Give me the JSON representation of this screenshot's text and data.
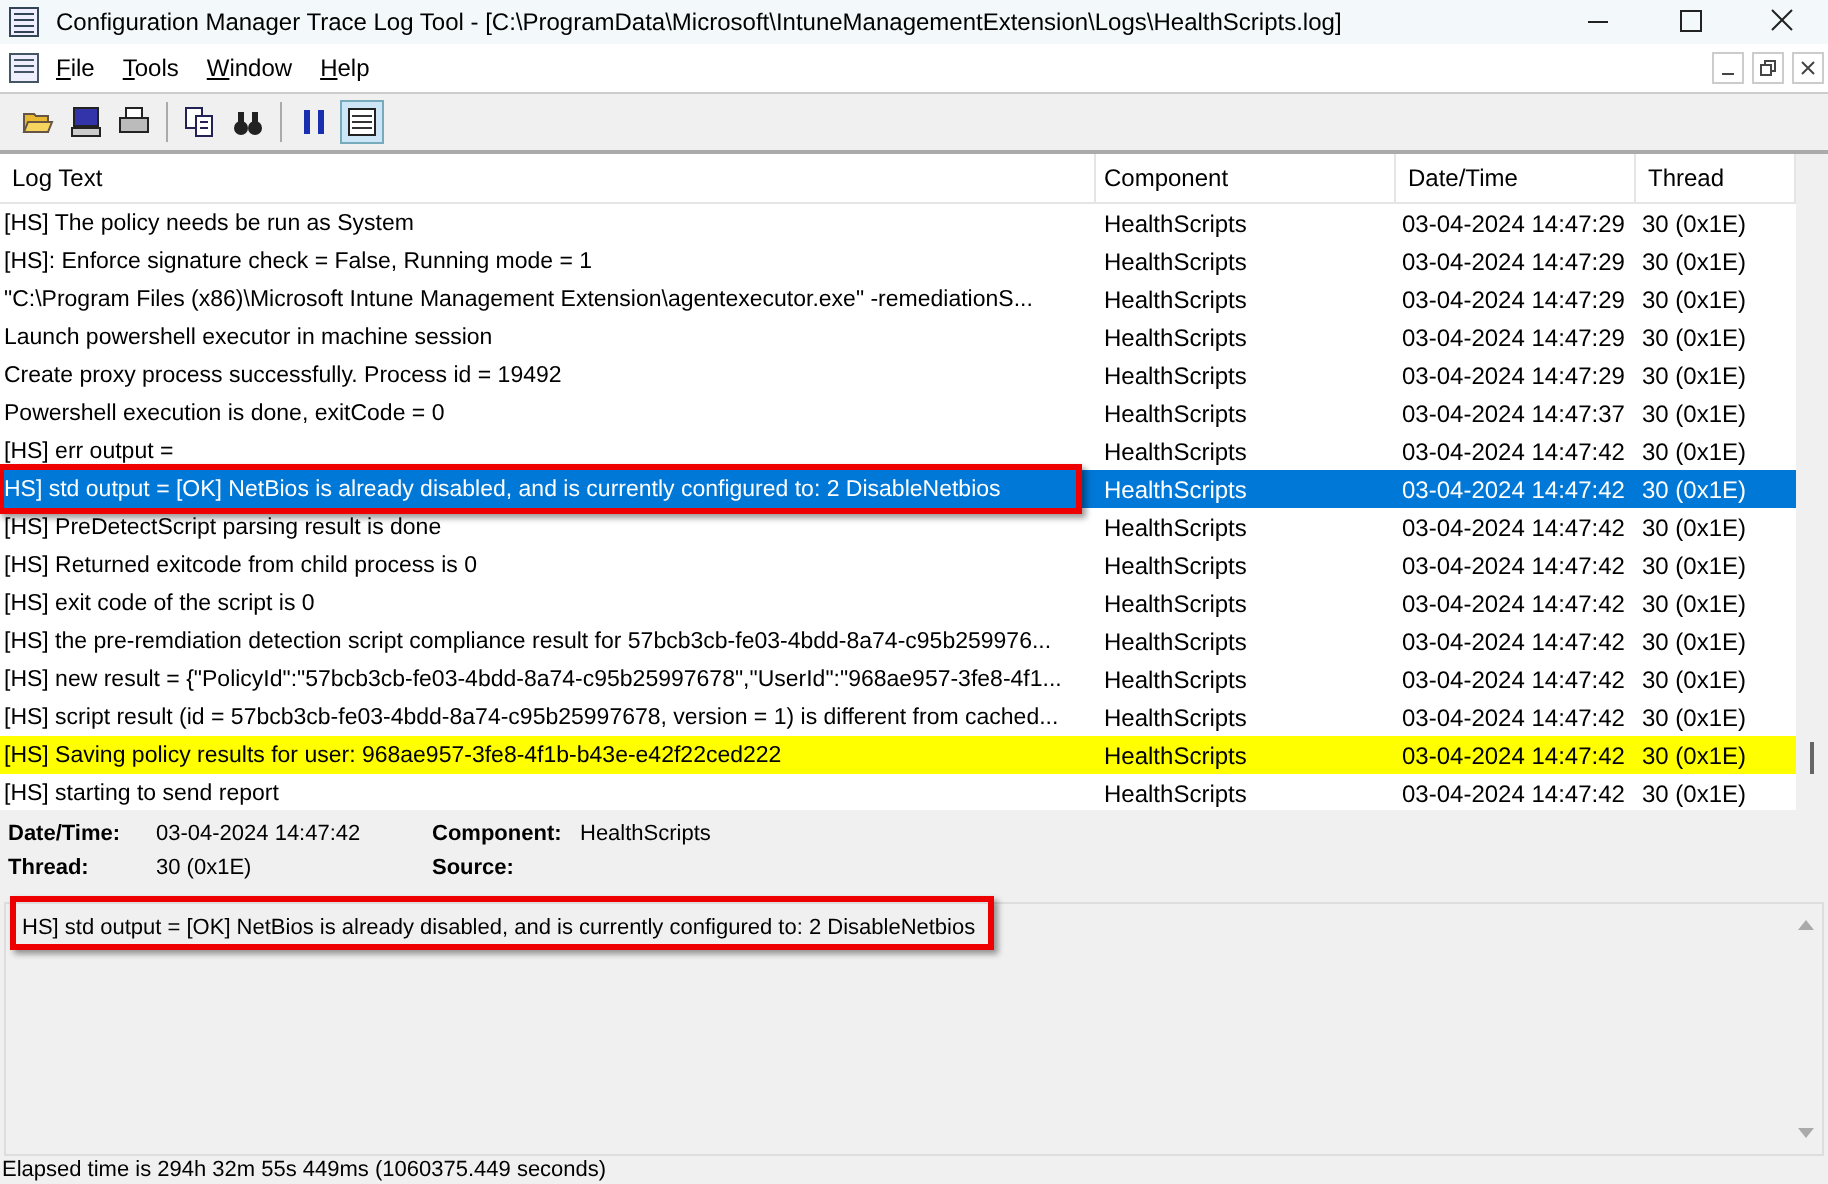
{
  "window": {
    "title": "Configuration Manager Trace Log Tool - [C:\\ProgramData\\Microsoft\\IntuneManagementExtension\\Logs\\HealthScripts.log]"
  },
  "menu": [
    {
      "label": "File"
    },
    {
      "label": "Tools"
    },
    {
      "label": "Window"
    },
    {
      "label": "Help"
    }
  ],
  "toolbar": [
    {
      "kind": "open",
      "pressed": false
    },
    {
      "kind": "computer",
      "pressed": false
    },
    {
      "kind": "print",
      "pressed": false
    },
    {
      "kind": "copy",
      "pressed": false
    },
    {
      "kind": "find",
      "pressed": false
    },
    {
      "kind": "pause",
      "pressed": false
    },
    {
      "kind": "view",
      "pressed": true
    }
  ],
  "table": {
    "columns": [
      "Log Text",
      "Component",
      "Date/Time",
      "Thread"
    ],
    "rows": [
      {
        "text": "[HS] The policy needs be run as System",
        "component": "HealthScripts",
        "datetime": "03-04-2024 14:47:29",
        "thread": "30 (0x1E)",
        "selected": false,
        "highlighted": false,
        "callout": false
      },
      {
        "text": "[HS]: Enforce signature check = False, Running mode = 1",
        "component": "HealthScripts",
        "datetime": "03-04-2024 14:47:29",
        "thread": "30 (0x1E)",
        "selected": false,
        "highlighted": false,
        "callout": false
      },
      {
        "text": "\"C:\\Program Files (x86)\\Microsoft Intune Management Extension\\agentexecutor.exe\"  -remediationS...",
        "component": "HealthScripts",
        "datetime": "03-04-2024 14:47:29",
        "thread": "30 (0x1E)",
        "selected": false,
        "highlighted": false,
        "callout": false
      },
      {
        "text": "Launch powershell executor in machine session",
        "component": "HealthScripts",
        "datetime": "03-04-2024 14:47:29",
        "thread": "30 (0x1E)",
        "selected": false,
        "highlighted": false,
        "callout": false
      },
      {
        "text": "Create proxy process successfully. Process id = 19492",
        "component": "HealthScripts",
        "datetime": "03-04-2024 14:47:29",
        "thread": "30 (0x1E)",
        "selected": false,
        "highlighted": false,
        "callout": false
      },
      {
        "text": "Powershell execution is done, exitCode = 0",
        "component": "HealthScripts",
        "datetime": "03-04-2024 14:47:37",
        "thread": "30 (0x1E)",
        "selected": false,
        "highlighted": false,
        "callout": false
      },
      {
        "text": "[HS] err output =",
        "component": "HealthScripts",
        "datetime": "03-04-2024 14:47:42",
        "thread": "30 (0x1E)",
        "selected": false,
        "highlighted": false,
        "callout": false
      },
      {
        "text": "HS] std output = [OK] NetBios is already disabled, and is currently configured to: 2 DisableNetbios",
        "component": "HealthScripts",
        "datetime": "03-04-2024 14:47:42",
        "thread": "30 (0x1E)",
        "selected": true,
        "highlighted": false,
        "callout": true
      },
      {
        "text": "[HS] PreDetectScript parsing result is done",
        "component": "HealthScripts",
        "datetime": "03-04-2024 14:47:42",
        "thread": "30 (0x1E)",
        "selected": false,
        "highlighted": false,
        "callout": false
      },
      {
        "text": "[HS] Returned exitcode from child process is 0",
        "component": "HealthScripts",
        "datetime": "03-04-2024 14:47:42",
        "thread": "30 (0x1E)",
        "selected": false,
        "highlighted": false,
        "callout": false
      },
      {
        "text": "[HS] exit code of the script is 0",
        "component": "HealthScripts",
        "datetime": "03-04-2024 14:47:42",
        "thread": "30 (0x1E)",
        "selected": false,
        "highlighted": false,
        "callout": false
      },
      {
        "text": "[HS] the pre-remdiation detection script compliance result for 57bcb3cb-fe03-4bdd-8a74-c95b259976...",
        "component": "HealthScripts",
        "datetime": "03-04-2024 14:47:42",
        "thread": "30 (0x1E)",
        "selected": false,
        "highlighted": false,
        "callout": false
      },
      {
        "text": "[HS] new result = {\"PolicyId\":\"57bcb3cb-fe03-4bdd-8a74-c95b25997678\",\"UserId\":\"968ae957-3fe8-4f1...",
        "component": "HealthScripts",
        "datetime": "03-04-2024 14:47:42",
        "thread": "30 (0x1E)",
        "selected": false,
        "highlighted": false,
        "callout": false
      },
      {
        "text": "[HS] script result (id = 57bcb3cb-fe03-4bdd-8a74-c95b25997678, version = 1) is different from cached...",
        "component": "HealthScripts",
        "datetime": "03-04-2024 14:47:42",
        "thread": "30 (0x1E)",
        "selected": false,
        "highlighted": false,
        "callout": false
      },
      {
        "text": "[HS] Saving policy results for user: 968ae957-3fe8-4f1b-b43e-e42f22ced222",
        "component": "HealthScripts",
        "datetime": "03-04-2024 14:47:42",
        "thread": "30 (0x1E)",
        "selected": false,
        "highlighted": true,
        "callout": false
      },
      {
        "text": "[HS] starting to send report",
        "component": "HealthScripts",
        "datetime": "03-04-2024 14:47:42",
        "thread": "30 (0x1E)",
        "selected": false,
        "highlighted": false,
        "callout": false
      }
    ]
  },
  "details": {
    "fields": [
      {
        "label": "Date/Time:",
        "value": "03-04-2024 14:47:42"
      },
      {
        "label": "Component:",
        "value": "HealthScripts"
      },
      {
        "label": "Thread:",
        "value": "30 (0x1E)"
      },
      {
        "label": "Source:"
      }
    ],
    "message": "HS] std output = [OK] NetBios is already disabled, and is currently configured to: 2 DisableNetbios",
    "callout": true
  },
  "status_bar": "Elapsed time is 294h 32m 55s 449ms (1060375.449 seconds)"
}
